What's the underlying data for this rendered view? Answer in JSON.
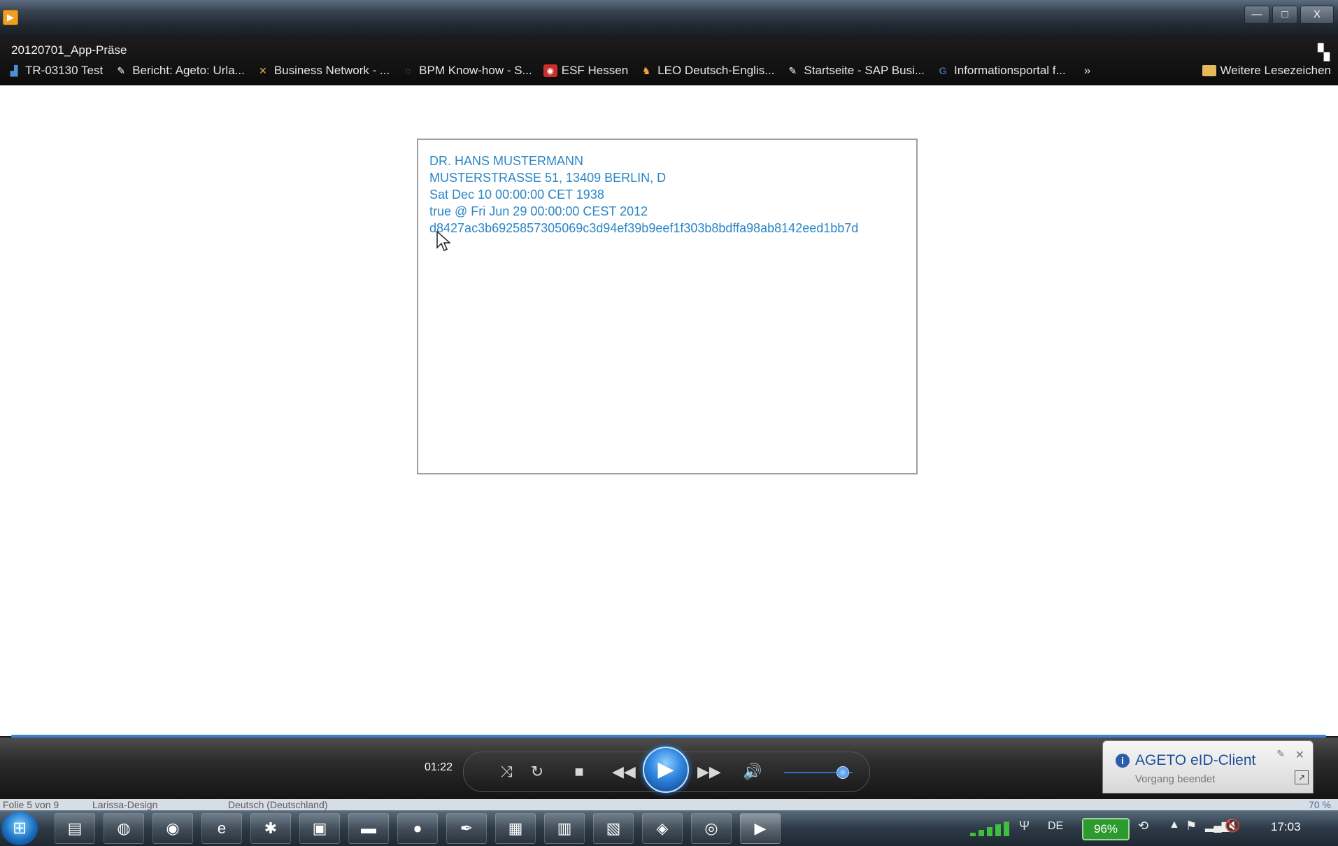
{
  "window": {
    "minimize": "—",
    "maximize": "□",
    "close": "X"
  },
  "browser": {
    "title": "20120701_App-Präse",
    "bookmarks": [
      {
        "label": "TR-03130 Test"
      },
      {
        "label": "Bericht: Ageto: Urla..."
      },
      {
        "label": "Business Network - ..."
      },
      {
        "label": "BPM Know-how - S..."
      },
      {
        "label": "ESF Hessen"
      },
      {
        "label": "LEO Deutsch-Englis..."
      },
      {
        "label": "Startseite - SAP Busi..."
      },
      {
        "label": "Informationsportal f..."
      }
    ],
    "overflow": "»",
    "more_bookmarks": "Weitere Lesezeichen"
  },
  "panel": {
    "lines": [
      "DR. HANS MUSTERMANN",
      "MUSTERSTRASSE 51, 13409 BERLIN, D",
      "Sat Dec 10 00:00:00 CET 1938",
      "true @ Fri Jun 29 00:00:00 CEST 2012",
      "d8427ac3b6925857305069c3d94ef39b9eef1f303b8bdffa98ab8142eed1bb7d"
    ]
  },
  "player": {
    "time": "01:22",
    "volume_level": 0.85
  },
  "notification": {
    "title": "AGETO eID-Client",
    "subtitle": "Vorgang beendet"
  },
  "statusbar": {
    "slide": "Folie 5 von 9",
    "theme": "Larissa-Design",
    "language": "Deutsch (Deutschland)",
    "zoom": "70 %"
  },
  "taskbar": {
    "language": "DE",
    "battery": "96%",
    "clock": "17:03"
  },
  "colors": {
    "panel_text": "#2a86c6",
    "accent": "#2e86df"
  }
}
